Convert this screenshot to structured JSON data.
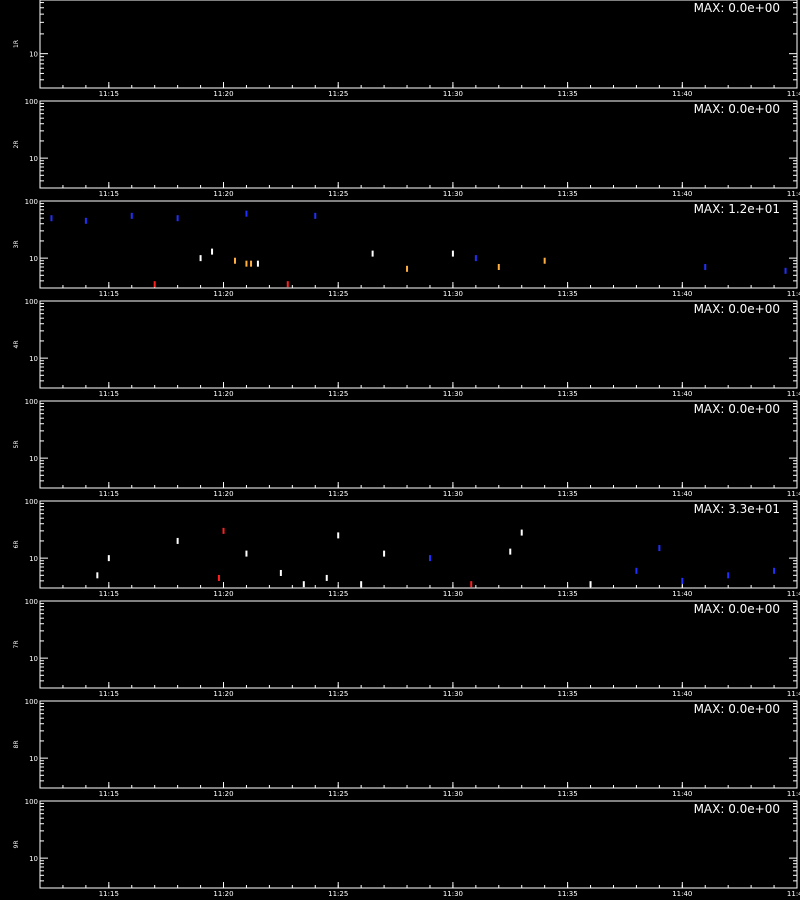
{
  "chart_data": [
    {
      "type": "heatmap",
      "ylabel": "1R",
      "max_label": "MAX: 0.0e+00",
      "x_ticks": [
        "11:15",
        "11:20",
        "11:25",
        "11:30",
        "11:35",
        "11:40",
        "11:45"
      ],
      "y_ticks": [
        "100",
        "10"
      ],
      "yscale": "log",
      "ylim": [
        3,
        100
      ],
      "points": []
    },
    {
      "type": "heatmap",
      "ylabel": "2R",
      "max_label": "MAX: 0.0e+00",
      "x_ticks": [
        "11:15",
        "11:20",
        "11:25",
        "11:30",
        "11:35",
        "11:40",
        "11:45"
      ],
      "y_ticks": [
        "100",
        "10"
      ],
      "yscale": "log",
      "ylim": [
        3,
        100
      ],
      "points": []
    },
    {
      "type": "heatmap",
      "ylabel": "3R",
      "max_label": "MAX: 1.2e+01",
      "x_ticks": [
        "11:15",
        "11:20",
        "11:25",
        "11:30",
        "11:35",
        "11:40",
        "11:45"
      ],
      "y_ticks": [
        "100",
        "10"
      ],
      "yscale": "log",
      "ylim": [
        3,
        100
      ],
      "points": [
        {
          "t": "11:17.0",
          "y": 3.5,
          "c": "red"
        },
        {
          "t": "11:19.0",
          "y": 10,
          "c": "white"
        },
        {
          "t": "11:19.5",
          "y": 13,
          "c": "white"
        },
        {
          "t": "11:20.5",
          "y": 9,
          "c": "orange"
        },
        {
          "t": "11:21.0",
          "y": 8,
          "c": "orange"
        },
        {
          "t": "11:21.2",
          "y": 8,
          "c": "orange"
        },
        {
          "t": "11:21.5",
          "y": 8,
          "c": "white"
        },
        {
          "t": "11:22.8",
          "y": 3.5,
          "c": "red"
        },
        {
          "t": "11:26.5",
          "y": 12,
          "c": "white"
        },
        {
          "t": "11:28.0",
          "y": 6.5,
          "c": "orange"
        },
        {
          "t": "11:30.0",
          "y": 12,
          "c": "white"
        },
        {
          "t": "11:31.0",
          "y": 10,
          "c": "blue"
        },
        {
          "t": "11:32.0",
          "y": 7,
          "c": "orange"
        },
        {
          "t": "11:34.0",
          "y": 9,
          "c": "orange"
        },
        {
          "t": "11:41.0",
          "y": 7,
          "c": "blue"
        },
        {
          "t": "11:44.5",
          "y": 6,
          "c": "blue"
        },
        {
          "t": "11:12.5",
          "y": 50,
          "c": "blue"
        },
        {
          "t": "11:14.0",
          "y": 45,
          "c": "blue"
        },
        {
          "t": "11:16.0",
          "y": 55,
          "c": "blue"
        },
        {
          "t": "11:18.0",
          "y": 50,
          "c": "blue"
        },
        {
          "t": "11:21.0",
          "y": 60,
          "c": "blue"
        },
        {
          "t": "11:24.0",
          "y": 55,
          "c": "blue"
        }
      ]
    },
    {
      "type": "heatmap",
      "ylabel": "4R",
      "max_label": "MAX: 0.0e+00",
      "x_ticks": [
        "11:15",
        "11:20",
        "11:25",
        "11:30",
        "11:35",
        "11:40",
        "11:45"
      ],
      "y_ticks": [
        "100",
        "10"
      ],
      "yscale": "log",
      "ylim": [
        3,
        100
      ],
      "points": []
    },
    {
      "type": "heatmap",
      "ylabel": "5R",
      "max_label": "MAX: 0.0e+00",
      "x_ticks": [
        "11:15",
        "11:20",
        "11:25",
        "11:30",
        "11:35",
        "11:40",
        "11:45"
      ],
      "y_ticks": [
        "100",
        "10"
      ],
      "yscale": "log",
      "ylim": [
        3,
        100
      ],
      "points": []
    },
    {
      "type": "heatmap",
      "ylabel": "6R",
      "max_label": "MAX: 3.3e+01",
      "x_ticks": [
        "11:15",
        "11:20",
        "11:25",
        "11:30",
        "11:35",
        "11:40",
        "11:45"
      ],
      "y_ticks": [
        "100",
        "10"
      ],
      "yscale": "log",
      "ylim": [
        3,
        100
      ],
      "points": [
        {
          "t": "11:14.5",
          "y": 5,
          "c": "white"
        },
        {
          "t": "11:15.0",
          "y": 10,
          "c": "white"
        },
        {
          "t": "11:19.8",
          "y": 4.5,
          "c": "red"
        },
        {
          "t": "11:21.0",
          "y": 12,
          "c": "white"
        },
        {
          "t": "11:22.5",
          "y": 5.5,
          "c": "white"
        },
        {
          "t": "11:23.5",
          "y": 3.5,
          "c": "white"
        },
        {
          "t": "11:24.5",
          "y": 4.5,
          "c": "white"
        },
        {
          "t": "11:26.0",
          "y": 3.5,
          "c": "white"
        },
        {
          "t": "11:27.0",
          "y": 12,
          "c": "white"
        },
        {
          "t": "11:29.0",
          "y": 10,
          "c": "blue"
        },
        {
          "t": "11:30.8",
          "y": 3.5,
          "c": "red"
        },
        {
          "t": "11:32.5",
          "y": 13,
          "c": "white"
        },
        {
          "t": "11:36.0",
          "y": 3.5,
          "c": "white"
        },
        {
          "t": "11:38.0",
          "y": 6,
          "c": "blue"
        },
        {
          "t": "11:40.0",
          "y": 4,
          "c": "blue"
        },
        {
          "t": "11:42.0",
          "y": 5,
          "c": "blue"
        },
        {
          "t": "11:44.0",
          "y": 6,
          "c": "blue"
        },
        {
          "t": "11:18.0",
          "y": 20,
          "c": "white"
        },
        {
          "t": "11:20.0",
          "y": 30,
          "c": "red"
        },
        {
          "t": "11:25.0",
          "y": 25,
          "c": "white"
        },
        {
          "t": "11:33.0",
          "y": 28,
          "c": "white"
        },
        {
          "t": "11:39.0",
          "y": 15,
          "c": "blue"
        }
      ]
    },
    {
      "type": "heatmap",
      "ylabel": "7R",
      "max_label": "MAX: 0.0e+00",
      "x_ticks": [
        "11:15",
        "11:20",
        "11:25",
        "11:30",
        "11:35",
        "11:40",
        "11:45"
      ],
      "y_ticks": [
        "100",
        "10"
      ],
      "yscale": "log",
      "ylim": [
        3,
        100
      ],
      "points": []
    },
    {
      "type": "heatmap",
      "ylabel": "8R",
      "max_label": "MAX: 0.0e+00",
      "x_ticks": [
        "11:15",
        "11:20",
        "11:25",
        "11:30",
        "11:35",
        "11:40",
        "11:45"
      ],
      "y_ticks": [
        "100",
        "10"
      ],
      "yscale": "log",
      "ylim": [
        3,
        100
      ],
      "points": []
    },
    {
      "type": "heatmap",
      "ylabel": "9R",
      "max_label": "MAX: 0.0e+00",
      "x_ticks": [
        "11:15",
        "11:20",
        "11:25",
        "11:30",
        "11:35",
        "11:40",
        "11:45"
      ],
      "y_ticks": [
        "100",
        "10"
      ],
      "yscale": "log",
      "ylim": [
        3,
        100
      ],
      "points": []
    }
  ],
  "colors": {
    "background": "#000000",
    "axes": "#ffffff",
    "white": "#ffffff",
    "red": "#ff2020",
    "orange": "#ffb040",
    "blue": "#2030ff"
  }
}
